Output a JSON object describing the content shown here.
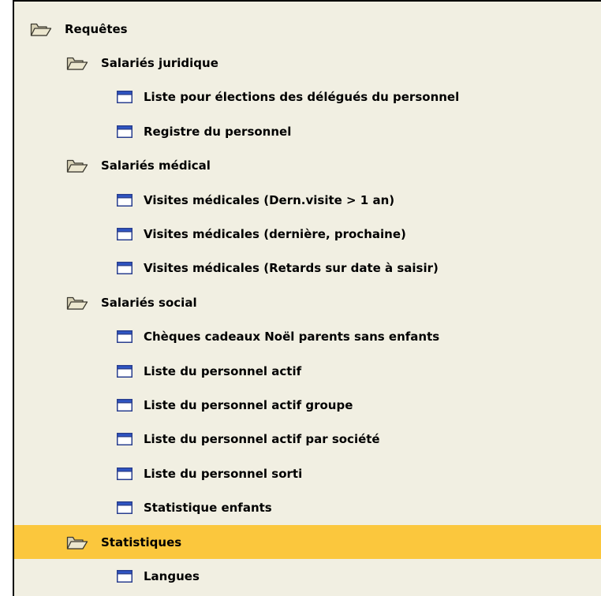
{
  "tree": [
    {
      "level": 0,
      "type": "folder",
      "icon": "folder-open-icon",
      "label": "Requêtes",
      "selected": false
    },
    {
      "level": 1,
      "type": "folder",
      "icon": "folder-open-icon",
      "label": "Salariés juridique",
      "selected": false
    },
    {
      "level": 2,
      "type": "item",
      "icon": "report-icon",
      "label": "Liste pour élections des délégués du personnel",
      "selected": false
    },
    {
      "level": 2,
      "type": "item",
      "icon": "report-icon",
      "label": "Registre du personnel",
      "selected": false
    },
    {
      "level": 1,
      "type": "folder",
      "icon": "folder-open-icon",
      "label": "Salariés médical",
      "selected": false
    },
    {
      "level": 2,
      "type": "item",
      "icon": "report-icon",
      "label": "Visites médicales (Dern.visite > 1 an)",
      "selected": false
    },
    {
      "level": 2,
      "type": "item",
      "icon": "report-icon",
      "label": "Visites médicales (dernière, prochaine)",
      "selected": false
    },
    {
      "level": 2,
      "type": "item",
      "icon": "report-icon",
      "label": "Visites médicales (Retards sur date à saisir)",
      "selected": false
    },
    {
      "level": 1,
      "type": "folder",
      "icon": "folder-open-icon",
      "label": "Salariés social",
      "selected": false
    },
    {
      "level": 2,
      "type": "item",
      "icon": "report-icon",
      "label": "Chèques cadeaux Noël parents sans enfants",
      "selected": false
    },
    {
      "level": 2,
      "type": "item",
      "icon": "report-icon",
      "label": "Liste du personnel actif",
      "selected": false
    },
    {
      "level": 2,
      "type": "item",
      "icon": "report-icon",
      "label": "Liste du personnel actif groupe",
      "selected": false
    },
    {
      "level": 2,
      "type": "item",
      "icon": "report-icon",
      "label": "Liste du personnel actif par société",
      "selected": false
    },
    {
      "level": 2,
      "type": "item",
      "icon": "report-icon",
      "label": "Liste du personnel sorti",
      "selected": false
    },
    {
      "level": 2,
      "type": "item",
      "icon": "report-icon",
      "label": "Statistique enfants",
      "selected": false
    },
    {
      "level": 1,
      "type": "folder",
      "icon": "folder-open-icon",
      "label": "Statistiques",
      "selected": true
    },
    {
      "level": 2,
      "type": "item",
      "icon": "report-icon",
      "label": "Langues",
      "selected": false
    }
  ],
  "colors": {
    "background": "#f1efe2",
    "selection": "#fbc73d",
    "text": "#000000"
  }
}
